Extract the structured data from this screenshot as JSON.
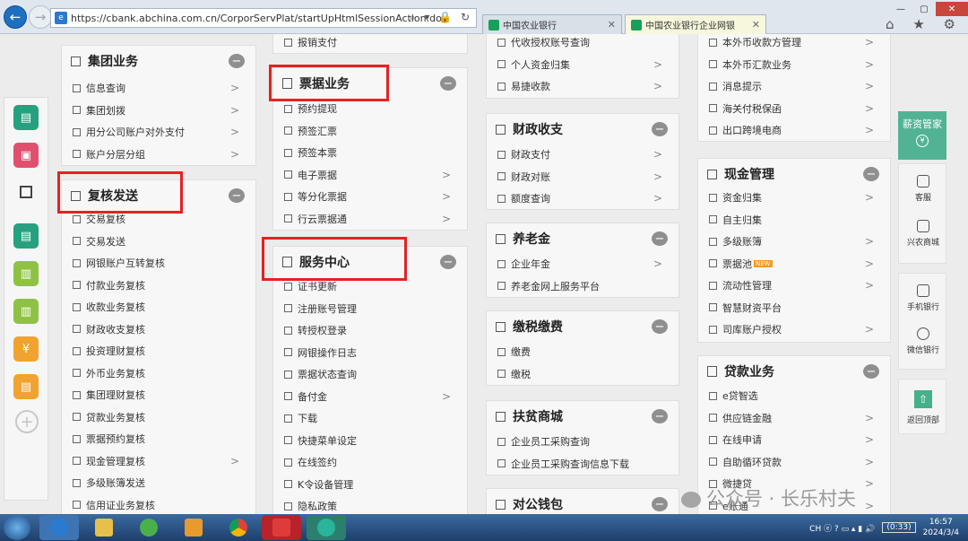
{
  "browser": {
    "address_url": "https://cbank.abchina.com.cn/CorporServPlat/startUpHtmlSessionAction.do",
    "address_tools": "⌕ ▾ 🔒 ↻",
    "tabs": [
      {
        "label": "中国农业银行",
        "close": "✕"
      },
      {
        "label": "中国农业银行企业网银",
        "close": "✕"
      }
    ],
    "right_tools": "⌂ ★ ⚙"
  },
  "columns": {
    "col1": [
      {
        "title": "集团业务",
        "items": [
          {
            "label": "信息查询",
            "arrow": ">"
          },
          {
            "label": "集团划拨",
            "arrow": ">"
          },
          {
            "label": "用分公司账户对外支付",
            "arrow": ">"
          },
          {
            "label": "账户分层分组",
            "arrow": ">"
          }
        ]
      },
      {
        "title": "复核发送",
        "items": [
          {
            "label": "交易复核",
            "arrow": ""
          },
          {
            "label": "交易发送",
            "arrow": ""
          },
          {
            "label": "网银账户互转复核",
            "arrow": ""
          },
          {
            "label": "付款业务复核",
            "arrow": ""
          },
          {
            "label": "收款业务复核",
            "arrow": ""
          },
          {
            "label": "财政收支复核",
            "arrow": ""
          },
          {
            "label": "投资理财复核",
            "arrow": ""
          },
          {
            "label": "外币业务复核",
            "arrow": ""
          },
          {
            "label": "集团理财复核",
            "arrow": ""
          },
          {
            "label": "贷款业务复核",
            "arrow": ""
          },
          {
            "label": "票据预约复核",
            "arrow": ""
          },
          {
            "label": "现金管理复核",
            "arrow": ">"
          },
          {
            "label": "多级账簿发送",
            "arrow": ""
          },
          {
            "label": "信用证业务复核",
            "arrow": ""
          }
        ]
      }
    ],
    "col2": [
      {
        "title": "",
        "items": [
          {
            "label": "报销支付",
            "arrow": ""
          }
        ]
      },
      {
        "title": "票据业务",
        "items": [
          {
            "label": "预约提现",
            "arrow": ""
          },
          {
            "label": "预签汇票",
            "arrow": ""
          },
          {
            "label": "预签本票",
            "arrow": ""
          },
          {
            "label": "电子票据",
            "arrow": ">"
          },
          {
            "label": "等分化票据",
            "arrow": ">"
          },
          {
            "label": "行云票据通",
            "arrow": ">"
          }
        ]
      },
      {
        "title": "服务中心",
        "items": [
          {
            "label": "证书更新",
            "arrow": ""
          },
          {
            "label": "注册账号管理",
            "arrow": ""
          },
          {
            "label": "转授权登录",
            "arrow": ""
          },
          {
            "label": "网银操作日志",
            "arrow": ""
          },
          {
            "label": "票据状态查询",
            "arrow": ""
          },
          {
            "label": "备付金",
            "arrow": ">"
          },
          {
            "label": "下载",
            "arrow": ""
          },
          {
            "label": "快捷菜单设定",
            "arrow": ""
          },
          {
            "label": "在线签约",
            "arrow": ""
          },
          {
            "label": "K令设备管理",
            "arrow": ""
          },
          {
            "label": "隐私政策",
            "arrow": ""
          }
        ]
      }
    ],
    "col3": [
      {
        "title": "",
        "items": [
          {
            "label": "代收授权账号查询",
            "arrow": ""
          },
          {
            "label": "个人资金归集",
            "arrow": ">"
          },
          {
            "label": "易捷收款",
            "arrow": ">"
          }
        ]
      },
      {
        "title": "财政收支",
        "items": [
          {
            "label": "财政支付",
            "arrow": ">"
          },
          {
            "label": "财政对账",
            "arrow": ">"
          },
          {
            "label": "额度查询",
            "arrow": ">"
          }
        ]
      },
      {
        "title": "养老金",
        "items": [
          {
            "label": "企业年金",
            "arrow": ">"
          },
          {
            "label": "养老金网上服务平台",
            "arrow": ""
          }
        ]
      },
      {
        "title": "缴税缴费",
        "items": [
          {
            "label": "缴费",
            "arrow": ""
          },
          {
            "label": "缴税",
            "arrow": ""
          }
        ]
      },
      {
        "title": "扶贫商城",
        "items": [
          {
            "label": "企业员工采购查询",
            "arrow": ""
          },
          {
            "label": "企业员工采购查询信息下载",
            "arrow": ""
          }
        ]
      },
      {
        "title": "对公钱包",
        "items": []
      }
    ],
    "col4": [
      {
        "title": "",
        "items": [
          {
            "label": "本外币收款方管理",
            "arrow": ">"
          },
          {
            "label": "本外币汇款业务",
            "arrow": ">"
          },
          {
            "label": "消息提示",
            "arrow": ">"
          },
          {
            "label": "海关付税保函",
            "arrow": ">"
          },
          {
            "label": "出口跨境电商",
            "arrow": ">"
          }
        ]
      },
      {
        "title": "现金管理",
        "items": [
          {
            "label": "资金归集",
            "arrow": ">"
          },
          {
            "label": "自主归集",
            "arrow": ""
          },
          {
            "label": "多级账簿",
            "arrow": ">"
          },
          {
            "label": "票据池",
            "arrow": ">",
            "badge": "NEW"
          },
          {
            "label": "流动性管理",
            "arrow": ">"
          },
          {
            "label": "智慧财资平台",
            "arrow": ""
          },
          {
            "label": "司库账户授权",
            "arrow": ">"
          }
        ]
      },
      {
        "title": "贷款业务",
        "items": [
          {
            "label": "e贷智选",
            "arrow": ""
          },
          {
            "label": "供应链金融",
            "arrow": ">"
          },
          {
            "label": "在线申请",
            "arrow": ">"
          },
          {
            "label": "自助循环贷款",
            "arrow": ">"
          },
          {
            "label": "微捷贷",
            "arrow": ">"
          },
          {
            "label": "e账通",
            "arrow": ">"
          }
        ]
      }
    ]
  },
  "right_rail": {
    "top_label": "薪资管家",
    "top_coin": "¥",
    "items": [
      "客服",
      "兴农商城",
      "手机银行",
      "微信银行",
      "返回顶部"
    ]
  },
  "watermark": "公众号 · 长乐村夫",
  "taskbar": {
    "battery": "(0:33)",
    "tray_text": "CH ⓔ ? ▭ ▴ ▮ 🔊",
    "time": "16:57",
    "date": "2024/3/4"
  }
}
